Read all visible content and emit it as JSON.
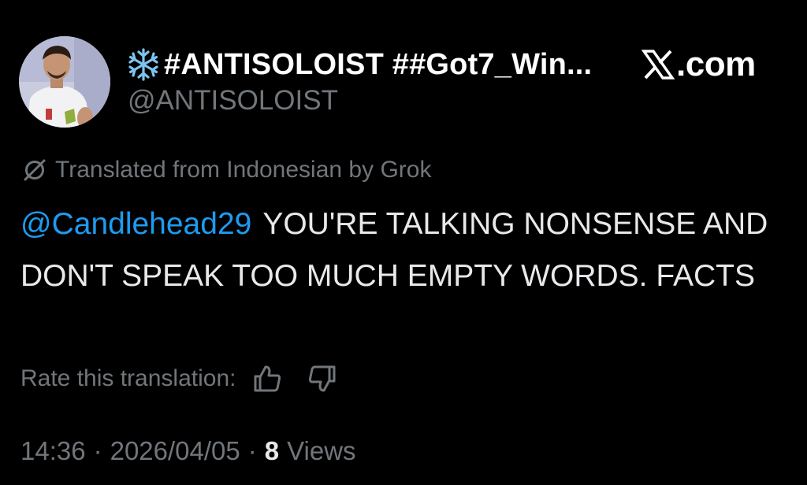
{
  "colors": {
    "background": "#000000",
    "text_primary": "#e7e9ea",
    "text_secondary": "#71767b",
    "mention": "#1d9bf0"
  },
  "author": {
    "avatar": "avatar",
    "name_icon": "snowflake-icon",
    "display_name": "#ANTISOLOIST ##Got7_Win...",
    "handle": "@ANTISOLOIST"
  },
  "site": {
    "logo_icon": "x-logo-icon",
    "label": ".com"
  },
  "translation": {
    "icon": "grok-icon",
    "notice": "Translated from Indonesian by Grok"
  },
  "tweet": {
    "mention": "@Candlehead29",
    "text": "YOU'RE TALKING NONSENSE AND DON'T SPEAK TOO MUCH EMPTY WORDS. FACTS"
  },
  "rating": {
    "label": "Rate this translation:",
    "thumbs_up_icon": "thumbs-up-icon",
    "thumbs_down_icon": "thumbs-down-icon"
  },
  "meta": {
    "time": "14:36",
    "separator": "·",
    "date": "2026/04/05",
    "views_count": "8",
    "views_label": "Views"
  }
}
